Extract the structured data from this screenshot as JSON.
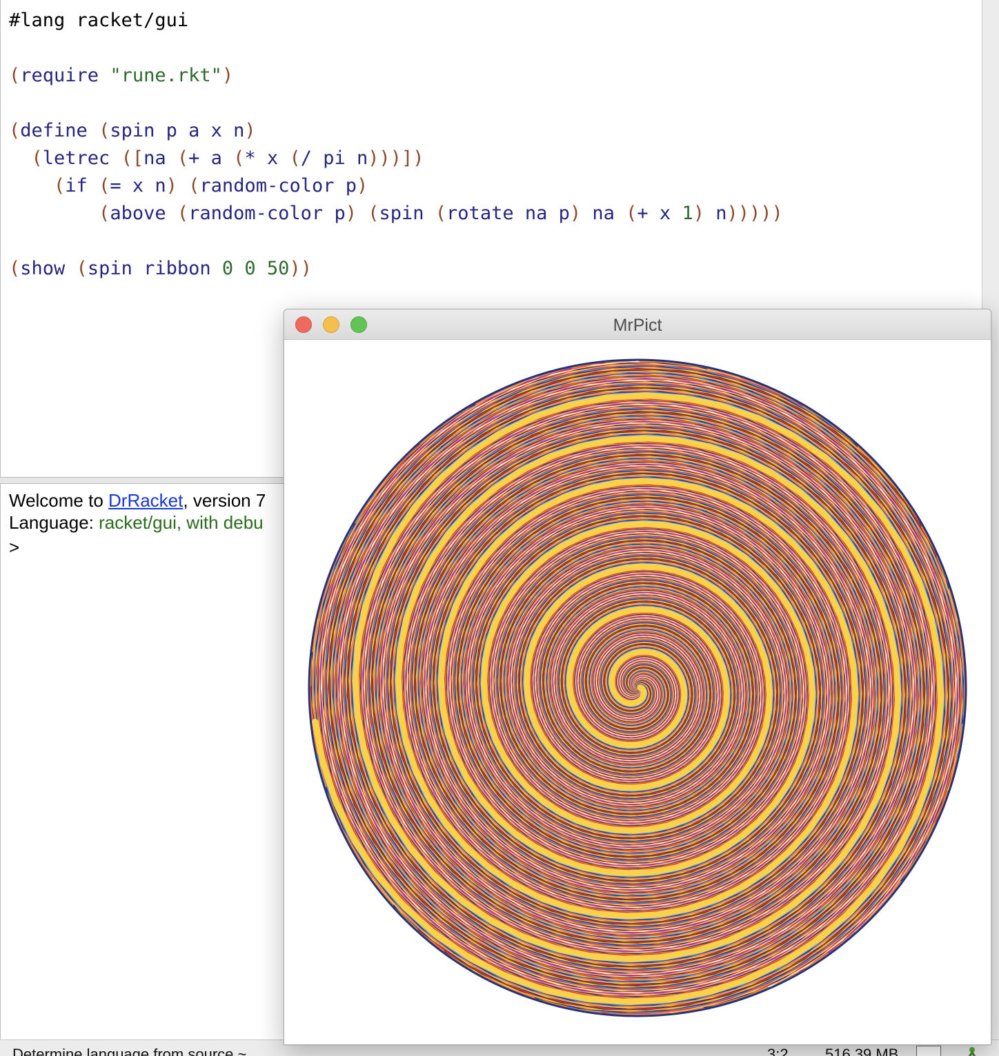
{
  "editor": {
    "lines": [
      {
        "tokens": [
          {
            "c": "k",
            "t": "#lang racket/gui"
          }
        ]
      },
      {
        "tokens": []
      },
      {
        "tokens": [
          {
            "c": "p",
            "t": "("
          },
          {
            "c": "id",
            "t": "require "
          },
          {
            "c": "s",
            "t": "\"rune.rkt\""
          },
          {
            "c": "p",
            "t": ")"
          }
        ]
      },
      {
        "tokens": []
      },
      {
        "tokens": [
          {
            "c": "p",
            "t": "("
          },
          {
            "c": "id",
            "t": "define "
          },
          {
            "c": "p",
            "t": "("
          },
          {
            "c": "id",
            "t": "spin p a x n"
          },
          {
            "c": "p",
            "t": ")"
          }
        ]
      },
      {
        "tokens": [
          {
            "c": "id",
            "t": "  "
          },
          {
            "c": "p",
            "t": "("
          },
          {
            "c": "id",
            "t": "letrec "
          },
          {
            "c": "p",
            "t": "(["
          },
          {
            "c": "id",
            "t": "na "
          },
          {
            "c": "p",
            "t": "("
          },
          {
            "c": "id",
            "t": "+ a "
          },
          {
            "c": "p",
            "t": "("
          },
          {
            "c": "id",
            "t": "* x "
          },
          {
            "c": "p",
            "t": "("
          },
          {
            "c": "id",
            "t": "/ pi n"
          },
          {
            "c": "p",
            "t": ")))])"
          }
        ]
      },
      {
        "tokens": [
          {
            "c": "id",
            "t": "    "
          },
          {
            "c": "p",
            "t": "("
          },
          {
            "c": "id",
            "t": "if "
          },
          {
            "c": "p",
            "t": "("
          },
          {
            "c": "id",
            "t": "= x n"
          },
          {
            "c": "p",
            "t": ")"
          },
          {
            "c": "id",
            "t": " "
          },
          {
            "c": "p",
            "t": "("
          },
          {
            "c": "id",
            "t": "random-color p"
          },
          {
            "c": "p",
            "t": ")"
          }
        ]
      },
      {
        "tokens": [
          {
            "c": "id",
            "t": "        "
          },
          {
            "c": "p",
            "t": "("
          },
          {
            "c": "id",
            "t": "above "
          },
          {
            "c": "p",
            "t": "("
          },
          {
            "c": "id",
            "t": "random-color p"
          },
          {
            "c": "p",
            "t": ")"
          },
          {
            "c": "id",
            "t": " "
          },
          {
            "c": "p",
            "t": "("
          },
          {
            "c": "id",
            "t": "spin "
          },
          {
            "c": "p",
            "t": "("
          },
          {
            "c": "id",
            "t": "rotate na p"
          },
          {
            "c": "p",
            "t": ")"
          },
          {
            "c": "id",
            "t": " na "
          },
          {
            "c": "p",
            "t": "("
          },
          {
            "c": "id",
            "t": "+ x "
          },
          {
            "c": "n",
            "t": "1"
          },
          {
            "c": "p",
            "t": ")"
          },
          {
            "c": "id",
            "t": " n"
          },
          {
            "c": "p",
            "t": ")))))"
          }
        ]
      },
      {
        "tokens": []
      },
      {
        "tokens": [
          {
            "c": "p",
            "t": "("
          },
          {
            "c": "id",
            "t": "show "
          },
          {
            "c": "p",
            "t": "("
          },
          {
            "c": "id",
            "t": "spin ribbon "
          },
          {
            "c": "n",
            "t": "0 0 50"
          },
          {
            "c": "p",
            "t": "))"
          }
        ]
      }
    ]
  },
  "interactions": {
    "welcome_prefix": "Welcome to ",
    "welcome_link": "DrRacket",
    "welcome_suffix": ", version 7",
    "language_label": "Language: ",
    "language_value": "racket/gui, with debu",
    "prompt": ">"
  },
  "statusbar": {
    "language_text": "Determine language from source ~",
    "position": "3:2",
    "memory": "516.39 MB"
  },
  "mrpict_window": {
    "title": "MrPict",
    "palette": [
      "#e8342b",
      "#23317e",
      "#fad24a",
      "#f08a30",
      "#ee8571",
      "#4a8ef0",
      "#8a3ee6",
      "#ffffff",
      "#6b3a1e"
    ]
  }
}
